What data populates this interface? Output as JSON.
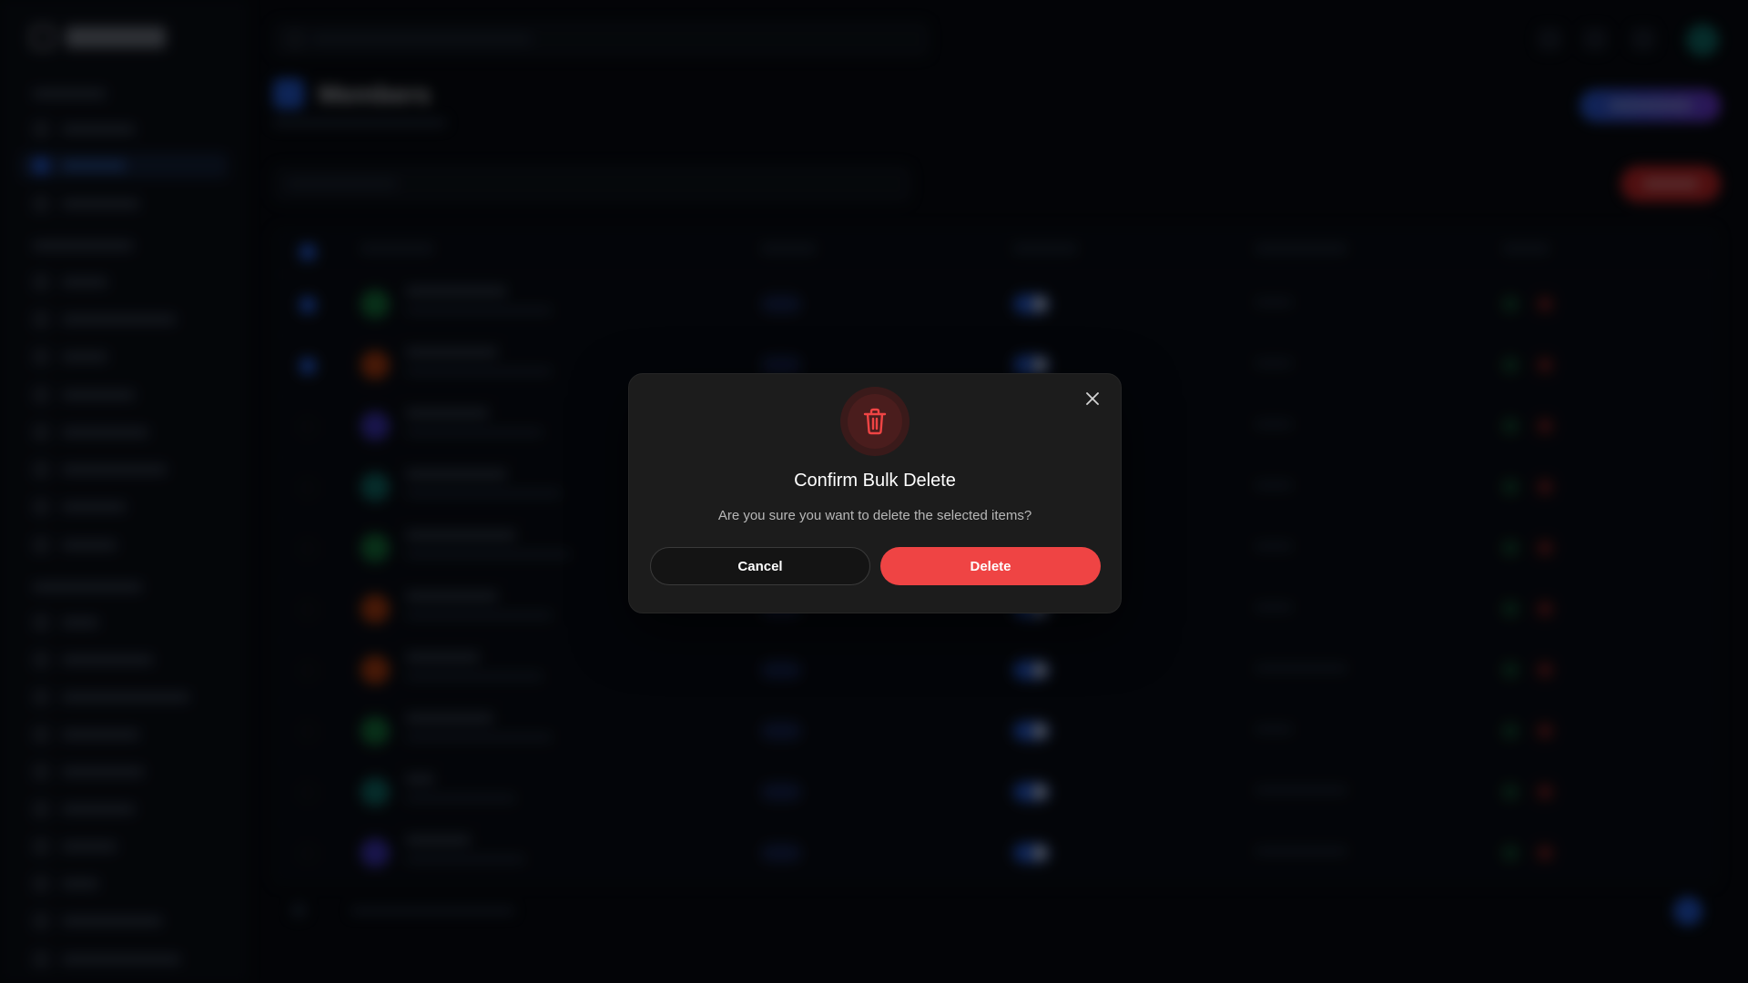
{
  "colors": {
    "modal_bg": "#1c1c1c",
    "danger": "#ef4444",
    "accent": "#2563eb"
  },
  "modal": {
    "title": "Confirm Bulk Delete",
    "message": "Are you sure you want to delete the selected items?",
    "cancel_label": "Cancel",
    "delete_label": "Delete",
    "icon": "trash-icon",
    "close_icon": "close-icon"
  },
  "background": {
    "page_title": "Members"
  }
}
